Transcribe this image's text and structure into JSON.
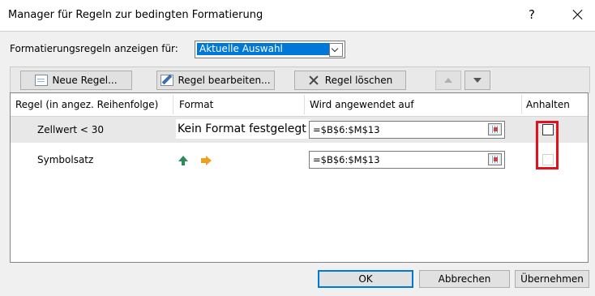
{
  "window": {
    "title": "Manager für Regeln zur bedingten Formatierung",
    "help": "?"
  },
  "show_for": {
    "label": "Formatierungsregeln anzeigen für:",
    "selected": "Aktuelle Auswahl"
  },
  "toolbar": {
    "new_rule": "Neue Regel...",
    "edit_rule": "Regel bearbeiten...",
    "delete_rule": "Regel löschen"
  },
  "grid": {
    "headers": [
      "Regel (in angez. Reihenfolge)",
      "Format",
      "Wird angewendet auf",
      "Anhalten"
    ],
    "rows": [
      {
        "rule": "Zellwert < 30",
        "format": "Kein Format festgelegt",
        "applies_to": "=$B$6:$M$13",
        "stop": false
      },
      {
        "rule": "Symbolsatz",
        "format_icons": [
          "arrow-up-green-icon",
          "arrow-right-yellow-icon"
        ],
        "applies_to": "=$B$6:$M$13",
        "stop": false
      }
    ]
  },
  "buttons": {
    "ok": "OK",
    "cancel": "Abbrechen",
    "apply": "Übernehmen"
  },
  "colors": {
    "selection": "#0078d7",
    "highlight": "#e3101e"
  }
}
